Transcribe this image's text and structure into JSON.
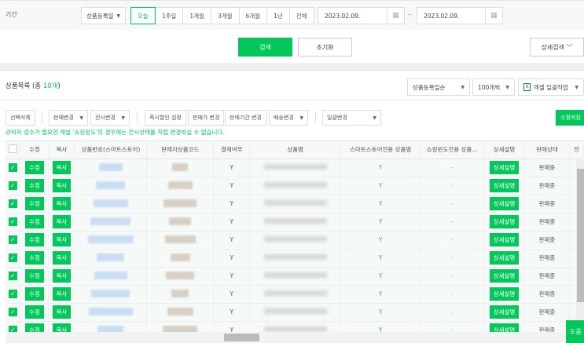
{
  "filter": {
    "label": "기간",
    "date_type": "상품등록일",
    "ranges": [
      "오늘",
      "1주일",
      "1개월",
      "3개월",
      "6개월",
      "1년",
      "전체"
    ],
    "active_range": "오늘",
    "start_date": "2023.02.09.",
    "end_date": "2023.02.09.",
    "tilde": "~"
  },
  "actions": {
    "search": "검색",
    "reset": "초기화",
    "detail_search": "상세검색 ﹀"
  },
  "list": {
    "title_prefix": "상품목록 (총 ",
    "count": "10개",
    "title_suffix": ")",
    "sort": "상품등록일순",
    "page_size": "100개씩",
    "excel": "엑셀 일괄작업"
  },
  "toolbar": {
    "delete": "선택삭제",
    "sale_change": "판매변경",
    "display_change": "전시변경",
    "discount": "즉시할인 설정",
    "price": "판매가 변경",
    "period": "판매기간 변경",
    "delivery": "배송변경",
    "bulk": "일괄변경",
    "save": "수정저장"
  },
  "notice": "관리자 검수가 필요한 채널 '쇼핑윈도'의 경우에는 전시상태를 직접 변경하실 수 없습니다.",
  "columns": [
    "수정",
    "복사",
    "상품번호(스마트스토어)",
    "판매자상품코드",
    "결제여부",
    "상품명",
    "스마트스토어전용 상품명",
    "쇼핑윈도전용 상품...",
    "상세설명",
    "판매상태",
    "전"
  ],
  "row_labels": {
    "edit": "수정",
    "copy": "복사",
    "detail": "상세설명"
  },
  "rows": [
    {
      "pay": "Y",
      "store_name": "Y",
      "window_name": "-",
      "status": "판매중"
    },
    {
      "pay": "Y",
      "store_name": "Y",
      "window_name": "-",
      "status": "판매중"
    },
    {
      "pay": "Y",
      "store_name": "Y",
      "window_name": "-",
      "status": "판매중"
    },
    {
      "pay": "Y",
      "store_name": "Y",
      "window_name": "-",
      "status": "판매중"
    },
    {
      "pay": "Y",
      "store_name": "Y",
      "window_name": "-",
      "status": "판매중"
    },
    {
      "pay": "Y",
      "store_name": "Y",
      "window_name": "-",
      "status": "판매중"
    },
    {
      "pay": "Y",
      "store_name": "Y",
      "window_name": "-",
      "status": "판매중"
    },
    {
      "pay": "Y",
      "store_name": "Y",
      "window_name": "-",
      "status": "판매중"
    },
    {
      "pay": "Y",
      "store_name": "Y",
      "window_name": "-",
      "status": "판매중"
    },
    {
      "pay": "Y",
      "store_name": "Y",
      "window_name": "-",
      "status": "판매중"
    }
  ],
  "help": "도움"
}
